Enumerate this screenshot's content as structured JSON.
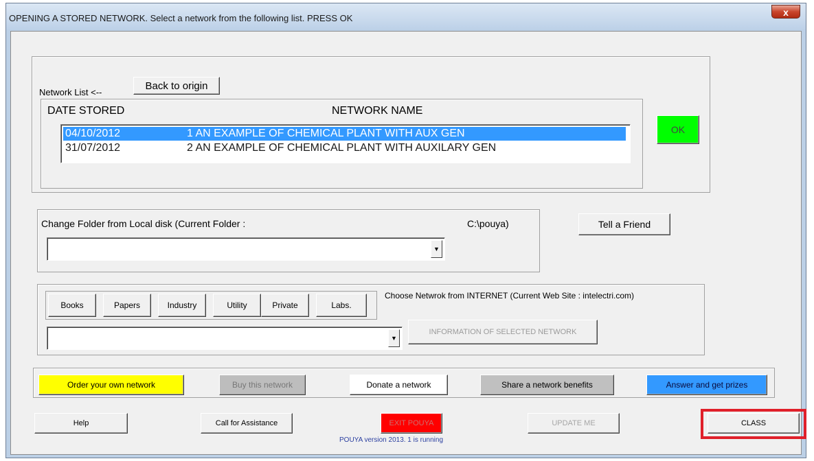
{
  "window": {
    "title": "OPENING A STORED NETWORK.   Select a network from the following list.   PRESS OK",
    "close_label": "x"
  },
  "network_list": {
    "label": "Network List <--",
    "back_button": "Back to origin",
    "col_date": "DATE STORED",
    "col_name": "NETWORK NAME",
    "rows": [
      {
        "date": "04/10/2012",
        "name": "1  AN EXAMPLE OF CHEMICAL PLANT WITH AUX GEN",
        "selected": true
      },
      {
        "date": "31/07/2012",
        "name": "2  AN EXAMPLE OF CHEMICAL PLANT WITH AUXILARY GEN",
        "selected": false
      }
    ],
    "ok_button": "OK"
  },
  "local_folder": {
    "label": "Change Folder from Local disk  (Current Folder :",
    "current_folder": "C:\\pouya)",
    "combo_value": "",
    "tell_friend_button": "Tell a Friend"
  },
  "internet": {
    "tabs": [
      "Books",
      "Papers",
      "Industry",
      "Utility",
      "Private",
      "Labs."
    ],
    "label": "Choose Netwrok from INTERNET   (Current Web Site : intelectri.com)",
    "combo_value": "",
    "info_button": "INFORMATION OF SELECTED NETWORK"
  },
  "actions": {
    "order": "Order your own network",
    "buy": "Buy this network",
    "donate": "Donate a network",
    "share": "Share a network benefits",
    "answer": "Answer and get prizes"
  },
  "bottom": {
    "help": "Help",
    "call": "Call for Assistance",
    "exit": "EXIT POUYA",
    "update": "UPDATE ME",
    "class": "CLASS",
    "version": "POUYA version 2013. 1 is running"
  },
  "colors": {
    "ok": "#00ff00",
    "order": "#ffff00",
    "exit": "#ff0000",
    "answer": "#3399ff",
    "selection": "#3399ff",
    "highlight_box": "#e0202a"
  }
}
